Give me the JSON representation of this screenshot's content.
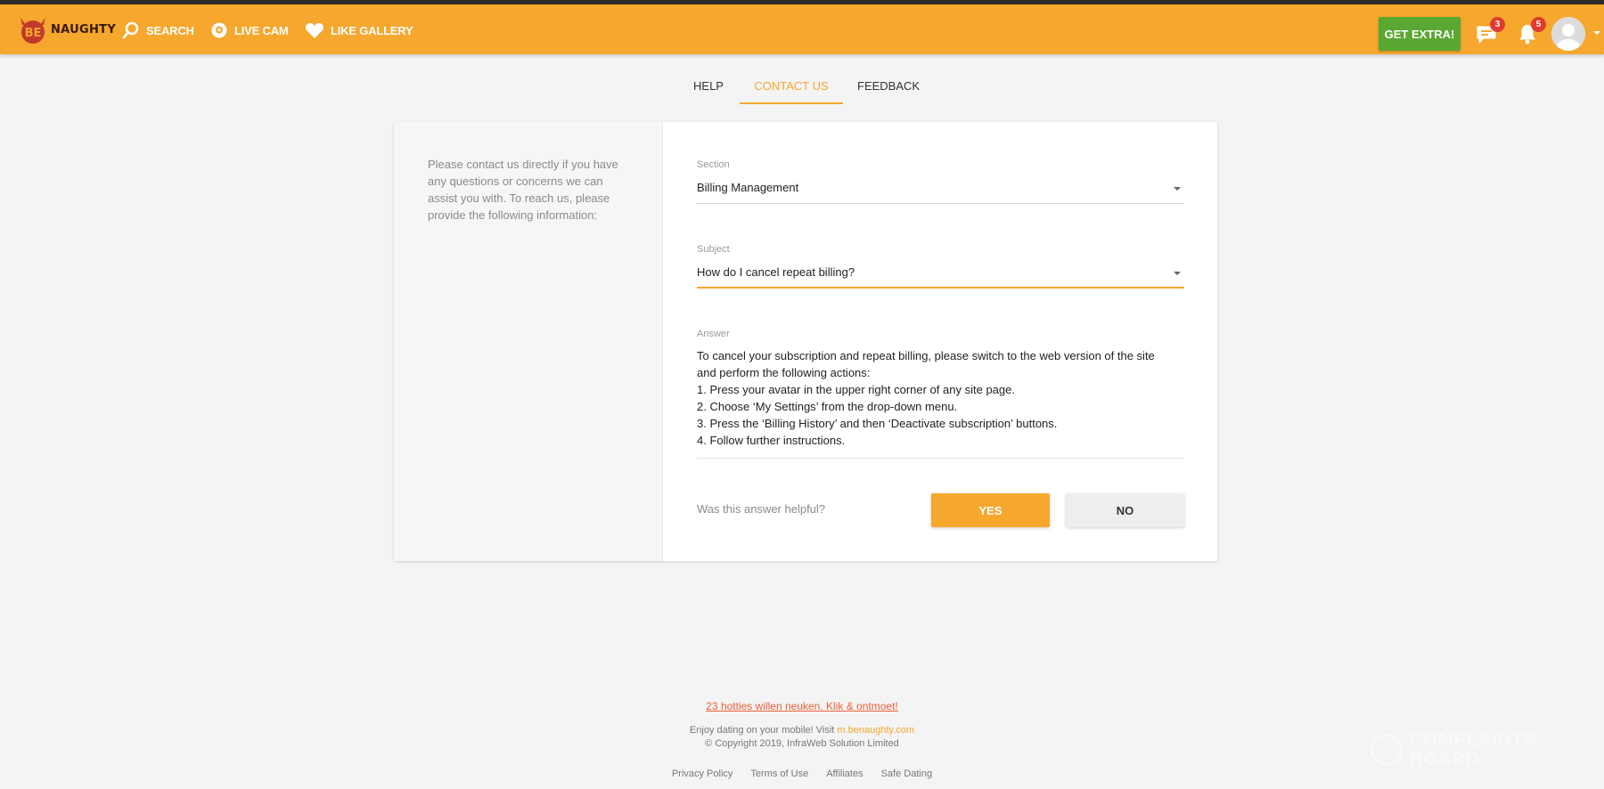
{
  "header": {
    "logo_text": "NAUGHTY",
    "nav": [
      {
        "label": "SEARCH"
      },
      {
        "label": "LIVE CAM"
      },
      {
        "label": "LIKE GALLERY"
      }
    ],
    "get_extra_label": "GET EXTRA!",
    "messages_count": "3",
    "notifications_count": "5"
  },
  "tabs": [
    {
      "label": "HELP"
    },
    {
      "label": "CONTACT US"
    },
    {
      "label": "FEEDBACK"
    }
  ],
  "contact": {
    "intro": "Please contact us directly if you have any questions or concerns we can assist you with. To reach us, please provide the following information:",
    "section_label": "Section",
    "section_value": "Billing Management",
    "subject_label": "Subject",
    "subject_value": "How do I cancel repeat billing?",
    "answer_label": "Answer",
    "answer_lines": [
      "To cancel your subscription and repeat billing, please switch to the web version of the site",
      "and perform the following actions:",
      "1. Press your avatar in the upper right corner of any site page.",
      "2. Choose ‘My Settings’ from the drop-down menu.",
      "3. Press the ‘Billing History’ and then ‘Deactivate subscription’ buttons.",
      "4. Follow further instructions."
    ],
    "helpful_question": "Was this answer helpful?",
    "yes_label": "YES",
    "no_label": "NO"
  },
  "footer": {
    "promo": "23 hotties willen neuken. Klik & ontmoet!",
    "mobile_prefix": "Enjoy dating on your mobile! Visit",
    "mobile_link": "m.benaughty.com",
    "copyright": "© Copyright 2019, InfraWeb Solution Limited",
    "links": [
      "Privacy Policy",
      "Terms of Use",
      "Affiliates",
      "Safe Dating"
    ]
  },
  "watermark": {
    "line1": "COMPLAINTS",
    "line2": "BOARD"
  },
  "colors": {
    "accent": "#f5a72e",
    "get_extra": "#5aa832",
    "badge": "#e23a2e",
    "promo_link": "#e8613a"
  }
}
